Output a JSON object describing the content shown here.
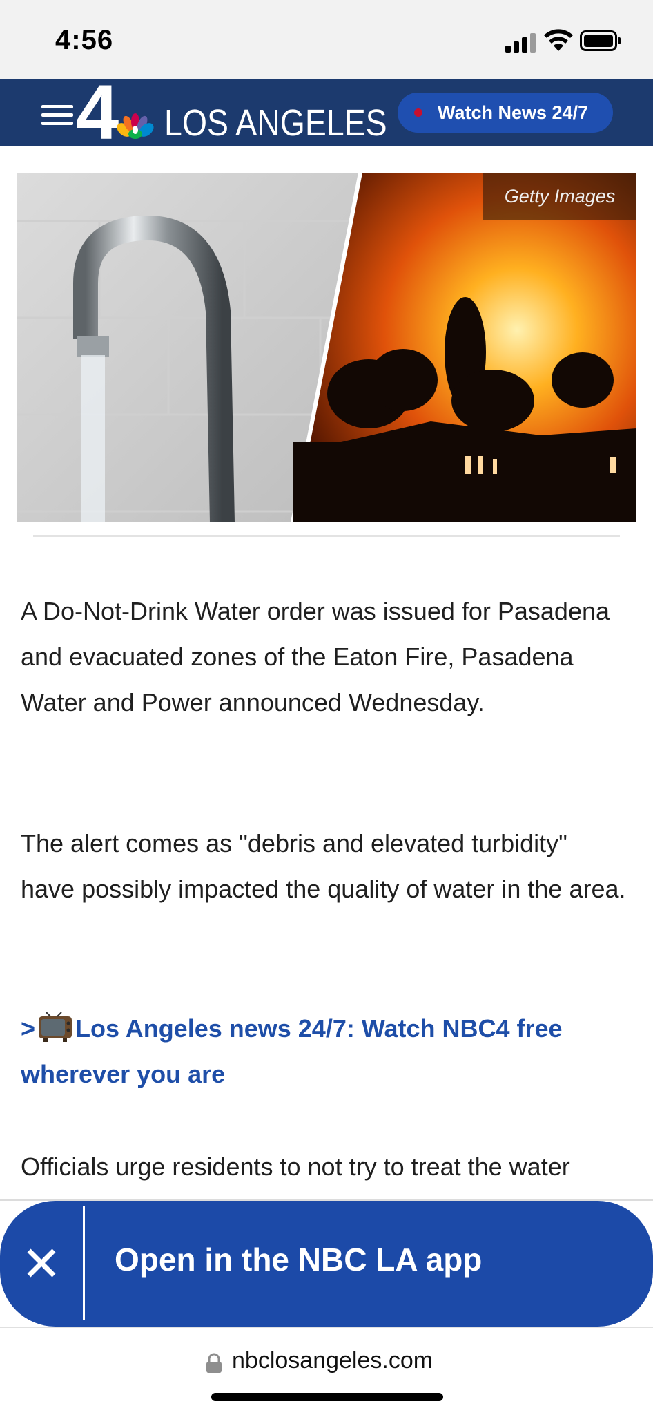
{
  "status_bar": {
    "time": "4:56"
  },
  "header": {
    "logo_number": "4",
    "logo_text": "LOS ANGELES",
    "watch_label": "Watch News 24/7",
    "accent_color": "#1c3a6e",
    "live_dot_color": "#c8102e"
  },
  "hero": {
    "credit": "Getty Images"
  },
  "article": {
    "paragraph_1": "A Do-Not-Drink Water order was issued for Pasadena and evacuated zones of the Eaton Fire, Pasadena Water and Power announced Wednesday.",
    "paragraph_2": "The alert comes as \"debris and elevated turbidity\" have possibly impacted the quality of water in the area.",
    "promo_prefix": ">",
    "promo_link": "Los Angeles news 24/7: Watch NBC4 free wherever you are",
    "paragraph_3": "Officials urge residents to not try to treat the water"
  },
  "app_banner": {
    "close_icon": "close-icon",
    "label": "Open in the NBC LA app",
    "color": "#1c4aa8"
  },
  "browser": {
    "url": "nbclosangeles.com",
    "lock_icon": "lock-icon"
  }
}
